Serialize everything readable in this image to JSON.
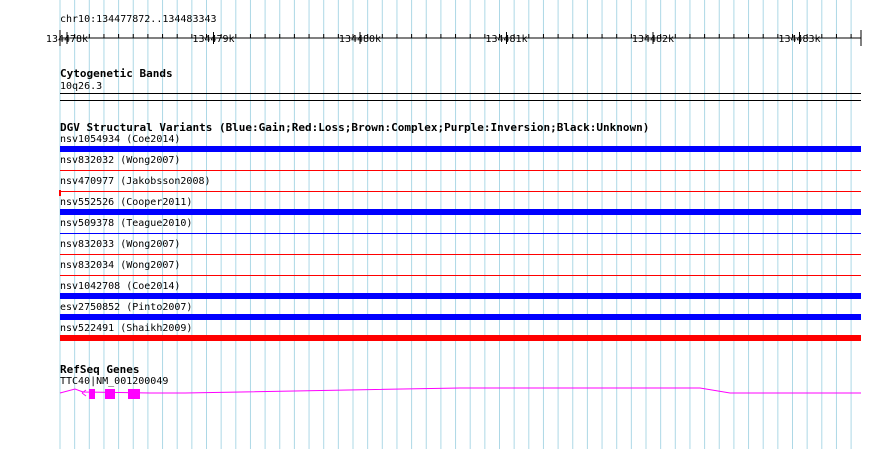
{
  "ruler": {
    "location": "chr10:134477872..134483343",
    "ticks": [
      "134478k",
      "134479k",
      "134480k",
      "134481k",
      "134482k",
      "134483k"
    ]
  },
  "cytoband": {
    "title": "Cytogenetic Bands",
    "band": "10q26.3"
  },
  "dgv": {
    "title": "DGV Structural Variants (Blue:Gain;Red:Loss;Brown:Complex;Purple:Inversion;Black:Unknown)",
    "variants": [
      {
        "label": "nsv1054934 (Coe2014)",
        "type": "gain"
      },
      {
        "label": "nsv832032 (Wong2007)",
        "type": "loss"
      },
      {
        "label": "nsv470977 (Jakobsson2008)",
        "type": "loss"
      },
      {
        "label": "nsv552526 (Cooper2011)",
        "type": "gain"
      },
      {
        "label": "nsv509378 (Teague2010)",
        "type": "gain"
      },
      {
        "label": "nsv832033 (Wong2007)",
        "type": "loss"
      },
      {
        "label": "nsv832034 (Wong2007)",
        "type": "loss"
      },
      {
        "label": "nsv1042708 (Coe2014)",
        "type": "gain"
      },
      {
        "label": "esv2750852 (Pinto2007)",
        "type": "gain"
      },
      {
        "label": "nsv522491 (Shaikh2009)",
        "type": "loss"
      }
    ]
  },
  "refseq": {
    "title": "RefSeq Genes",
    "gene_label": "TTC40|NM_001200049"
  },
  "colors": {
    "gain": "#0000ff",
    "loss": "#ff0000",
    "gene": "#ff00ff",
    "grid": "#add8e6"
  }
}
